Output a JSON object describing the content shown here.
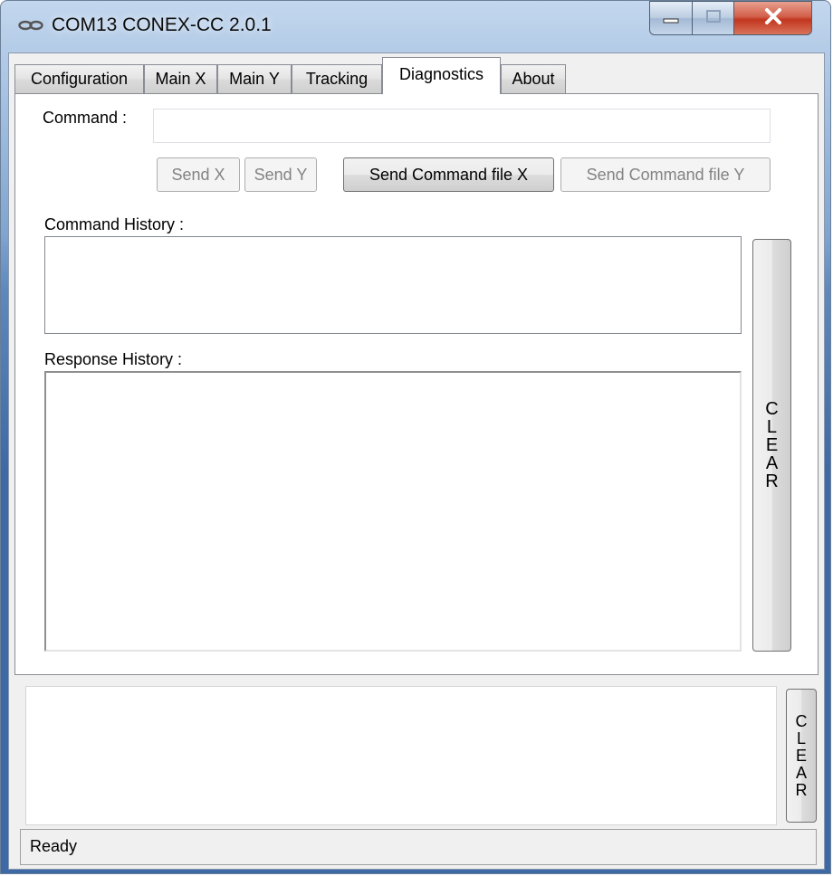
{
  "window": {
    "title": "COM13  CONEX-CC 2.0.1",
    "app_icon": "link-chain-icon",
    "buttons": {
      "minimize": "minimize-icon",
      "maximize": "maximize-icon",
      "close": "close-icon"
    }
  },
  "tabs": [
    {
      "label": "Configuration",
      "active": false
    },
    {
      "label": "Main X",
      "active": false
    },
    {
      "label": "Main Y",
      "active": false
    },
    {
      "label": "Tracking",
      "active": false
    },
    {
      "label": "Diagnostics",
      "active": true
    },
    {
      "label": "About",
      "active": false
    }
  ],
  "diagnostics": {
    "command_label": "Command :",
    "command_value": "",
    "send_x": "Send X",
    "send_y": "Send Y",
    "send_file_x": "Send Command file X",
    "send_file_y": "Send Command file Y",
    "command_history_label": "Command History :",
    "response_history_label": "Response History :",
    "clear_label": "C\nL\nE\nA\nR"
  },
  "log": {
    "clear_label": "C\nL\nE\nA\nR"
  },
  "status": {
    "text": "Ready"
  }
}
